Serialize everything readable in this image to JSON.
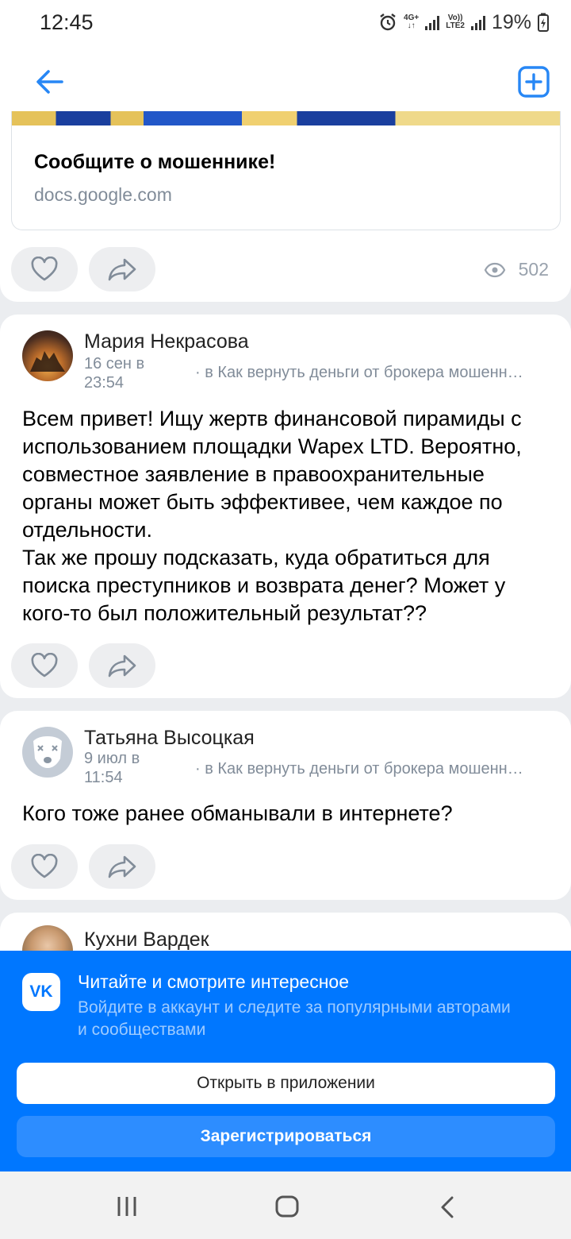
{
  "status_bar": {
    "time": "12:45",
    "network_1": "4G+",
    "network_2_top": "Vo))",
    "network_2_bottom": "LTE2",
    "battery": "19%"
  },
  "nav": {
    "back_icon": "arrow-left-icon",
    "add_icon": "plus-square-icon"
  },
  "link_card": {
    "title": "Сообщите о мошеннике!",
    "domain": "docs.google.com",
    "views": "502"
  },
  "posts": [
    {
      "author": "Мария Некрасова",
      "date": "16 сен в 23:54",
      "group": "· в Как вернуть деньги от брокера мошенн…",
      "text": "Всем привет! Ищу жертв финансовой пирамиды с использованием площадки Wapex LTD. Вероятно, совместное заявление в правоохранительные органы может быть эффективее, чем каждое по отдельности.\nТак же прошу подсказать, куда обратиться для поиска преступников и возврата денег? Может у кого-то был положительный результат??"
    },
    {
      "author": "Татьяна Высоцкая",
      "date": "9 июл в 11:54",
      "group": "· в Как вернуть деньги от брокера мошенн…",
      "text": "Кого тоже ранее обманывали в интернете?"
    },
    {
      "author": "Кухни Вардек"
    }
  ],
  "banner": {
    "logo": "VK",
    "title": "Читайте и смотрите интересное",
    "subtitle": "Войдите в аккаунт и следите за популярными авторами и сообществами",
    "open_label": "Открыть в приложении",
    "register_label": "Зарегистрироваться"
  },
  "colors": {
    "accent": "#0077ff",
    "icon_blue": "#2787f5",
    "secondary_text": "#818c99"
  }
}
